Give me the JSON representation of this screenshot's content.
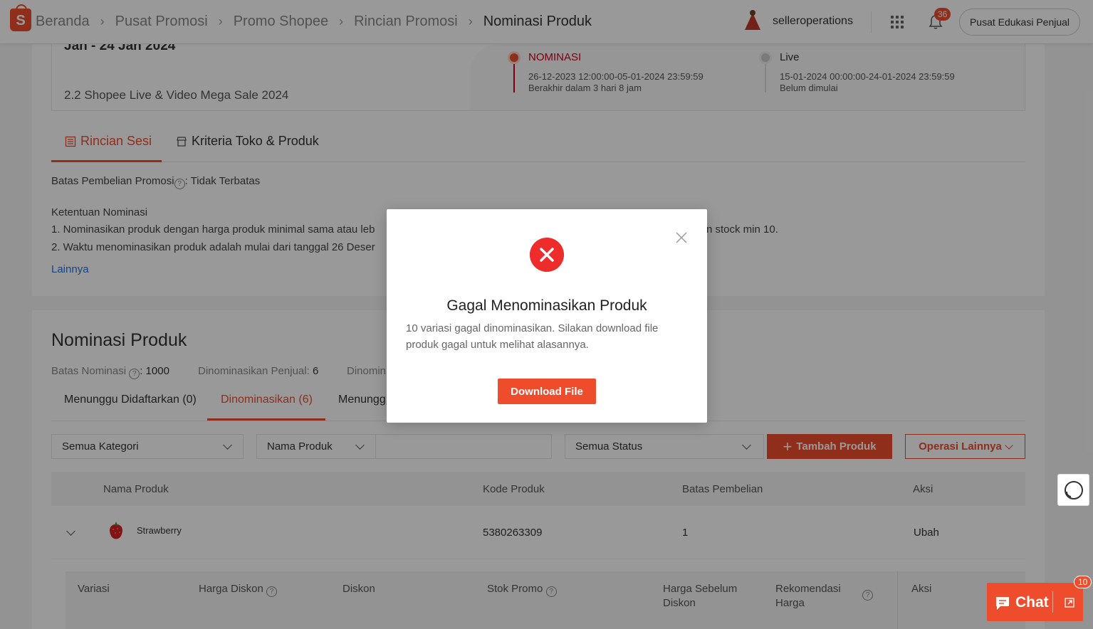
{
  "header": {
    "breadcrumbs": [
      "Beranda",
      "Pusat Promosi",
      "Promo Shopee",
      "Rincian Promosi",
      "Nominasi Produk"
    ],
    "username": "selleroperations",
    "notification_count": "36",
    "edu_button": "Pusat Edukasi Penjual"
  },
  "promo": {
    "date_range": "Jan - 24 Jan 2024",
    "name": "2.2 Shopee Live & Video Mega Sale 2024",
    "timeline": [
      {
        "title": "NOMINASI",
        "period": "26-12-2023 12:00:00-05-01-2024 23:59:59",
        "status": "Berakhir dalam 3 hari 8 jam"
      },
      {
        "title": "Live",
        "period": "15-01-2024 00:00:00-24-01-2024 23:59:59",
        "status": "Belum dimulai"
      }
    ]
  },
  "detail_tabs": [
    "Rincian Sesi",
    "Kriteria Toko & Produk"
  ],
  "session": {
    "limit_label": "Batas Pembelian Promosi",
    "limit_value": ": Tidak Terbatas",
    "rules_title": "Ketentuan Nominasi",
    "rule1_start": "1. Nominasikan produk dengan harga produk minimal sama atau leb",
    "rule1_end": "n stock min 10.",
    "rule2": "2. Waktu menominasikan produk adalah mulai dari tanggal 26 Deser",
    "more_link": "Lainnya"
  },
  "nomination": {
    "title": "Nominasi Produk",
    "limit_label": "Batas Nominasi",
    "limit_value": ": 1000",
    "by_seller_label": "Dinominasikan Penjual:",
    "by_seller_value": "6",
    "third_stat": "Dinomin",
    "tabs": [
      "Menunggu Didaftarkan (0)",
      "Dinominasikan (6)",
      "Menungg"
    ]
  },
  "filters": {
    "category": "Semua Kategori",
    "search_type": "Nama Produk",
    "search_value": "",
    "status": "Semua Status",
    "add_button": "Tambah Produk",
    "ops_button": "Operasi Lainnya"
  },
  "table": {
    "headers": [
      "Nama Produk",
      "Kode Produk",
      "Batas Pembelian",
      "Aksi"
    ],
    "rows": [
      {
        "name": "Strawberry",
        "code": "5380263309",
        "limit": "1",
        "action": "Ubah"
      }
    ],
    "sub_headers": [
      "Variasi",
      "Harga Diskon",
      "Diskon",
      "Stok Promo",
      "Harga Sebelum Diskon",
      "Rekomendasi Harga",
      "Aksi"
    ]
  },
  "chat": {
    "label": "Chat",
    "badge": "10"
  },
  "modal": {
    "title": "Gagal Menominasikan Produk",
    "message": "10 variasi gagal dinominasikan. Silakan download file produk gagal untuk melihat alasannya.",
    "button": "Download File"
  },
  "colors": {
    "brand": "#ee4d2d",
    "error": "#ee2c2c",
    "link": "#2673dd"
  }
}
